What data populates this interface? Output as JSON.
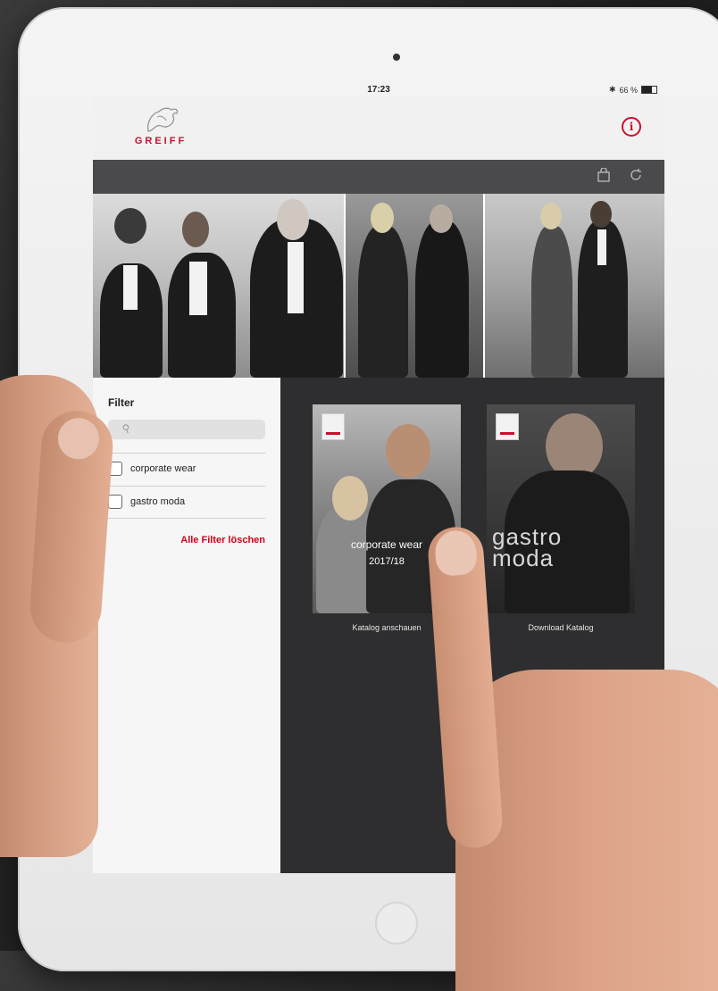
{
  "status_bar": {
    "time": "17:23",
    "battery": "66 %",
    "battery_level": 0.66
  },
  "header": {
    "logo_text": "GREIFF",
    "info_icon": "info-icon"
  },
  "toolbar": {
    "icons": [
      "bag-icon",
      "refresh-icon"
    ]
  },
  "filter": {
    "title": "Filter",
    "search_placeholder": "",
    "options": [
      {
        "label": "corporate wear",
        "checked": false
      },
      {
        "label": "gastro moda",
        "checked": false
      }
    ],
    "clear_all": "Alle Filter löschen"
  },
  "catalogs": [
    {
      "cover_title": "corporate wear",
      "cover_year": "2017/18",
      "action": "Katalog anschauen"
    },
    {
      "cover_title": "gastro moda",
      "action": "Download Katalog"
    }
  ],
  "colors": {
    "brand_red": "#c8102e",
    "toolbar": "#4a4a4c",
    "catalog_bg": "#2e2e30"
  }
}
